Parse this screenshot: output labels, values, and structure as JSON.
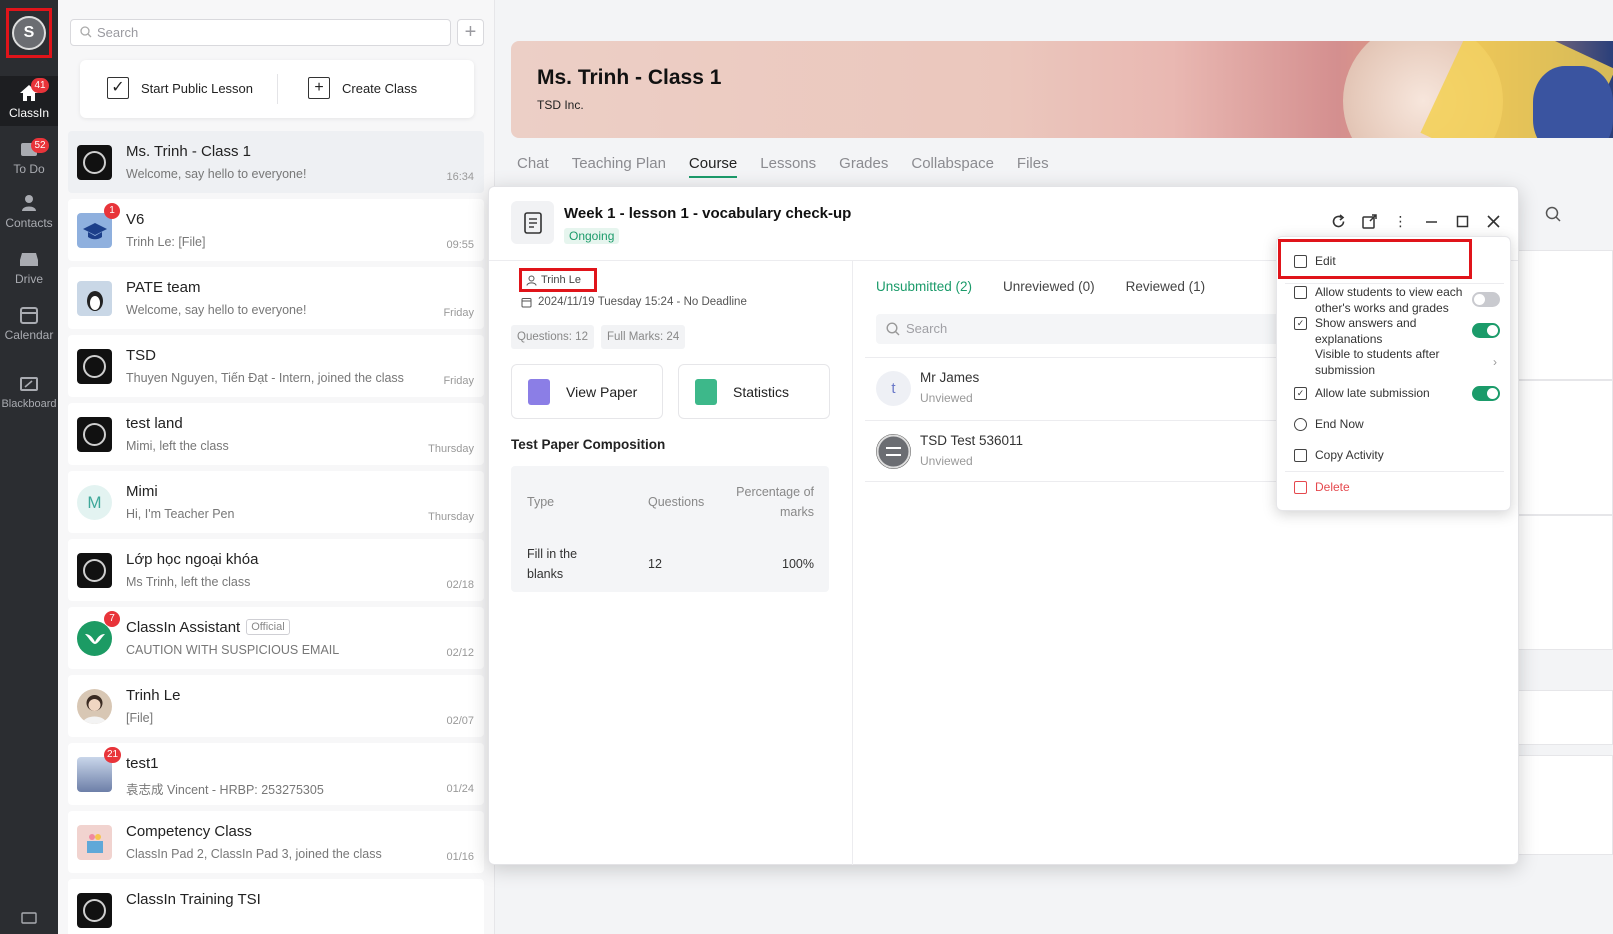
{
  "rail": {
    "items": [
      {
        "label": "ClassIn",
        "badge": "41",
        "icon": "home-icon"
      },
      {
        "label": "To Do",
        "badge": "52",
        "icon": "todo-icon"
      },
      {
        "label": "Contacts",
        "badge": "",
        "icon": "contacts-icon"
      },
      {
        "label": "Drive",
        "badge": "",
        "icon": "drive-icon"
      },
      {
        "label": "Calendar",
        "badge": "",
        "icon": "calendar-icon"
      },
      {
        "label": "Blackboard",
        "badge": "",
        "icon": "blackboard-icon"
      }
    ]
  },
  "list": {
    "search_placeholder": "Search",
    "start_public_lesson": "Start Public Lesson",
    "create_class": "Create Class",
    "chats": [
      {
        "title": "Ms. Trinh - Class 1",
        "sub": "Welcome, say hello to everyone!",
        "time": "16:34",
        "badge": ""
      },
      {
        "title": "V6",
        "sub": "Trinh Le: [File]",
        "time": "09:55",
        "badge": "1"
      },
      {
        "title": "PATE team",
        "sub": "Welcome, say hello to everyone!",
        "time": "Friday",
        "badge": ""
      },
      {
        "title": "TSD",
        "sub": "Thuyen Nguyen, Tiến Đạt - Intern, joined the class",
        "time": "Friday",
        "badge": ""
      },
      {
        "title": "test land",
        "sub": "Mimi, left the class",
        "time": "Thursday",
        "badge": ""
      },
      {
        "title": "Mimi",
        "sub": "Hi, I'm Teacher Pen",
        "time": "Thursday",
        "badge": ""
      },
      {
        "title": "Lớp học ngoại khóa",
        "sub": "Ms Trinh, left the class",
        "time": "02/18",
        "badge": ""
      },
      {
        "title": "ClassIn Assistant",
        "sub": "CAUTION WITH SUSPICIOUS EMAIL",
        "time": "02/12",
        "badge": "7",
        "tag": "Official"
      },
      {
        "title": "Trinh Le",
        "sub": "[File]",
        "time": "02/07",
        "badge": ""
      },
      {
        "title": "test1",
        "sub": "袁志成 Vincent - HRBP: 253275305",
        "time": "01/24",
        "badge": "21"
      },
      {
        "title": "Competency Class",
        "sub": "ClassIn Pad 2, ClassIn Pad 3, joined the class",
        "time": "01/16",
        "badge": ""
      },
      {
        "title": "ClassIn Training TSI",
        "sub": "",
        "time": "",
        "badge": ""
      }
    ],
    "mimi_initial": "M"
  },
  "class": {
    "title": "Ms. Trinh - Class 1",
    "org": "TSD Inc.",
    "tabs": [
      "Chat",
      "Teaching Plan",
      "Course",
      "Lessons",
      "Grades",
      "Collabspace",
      "Files"
    ],
    "active_tab": "Course"
  },
  "activity": {
    "title": "Week 1 - lesson 1 - vocabulary check-up",
    "status": "Ongoing",
    "owner": "Trinh Le",
    "date": "2024/11/19 Tuesday 15:24 - No Deadline",
    "questions_chip": "Questions: 12",
    "marks_chip": "Full Marks: 24",
    "view_paper": "View Paper",
    "statistics": "Statistics",
    "composition_title": "Test Paper Composition",
    "table": {
      "headers": [
        "Type",
        "Questions",
        "Percentage of marks"
      ],
      "row": [
        "Fill in the blanks",
        "12",
        "100%"
      ]
    },
    "sub_tabs": [
      "Unsubmitted (2)",
      "Unreviewed (0)",
      "Reviewed (1)"
    ],
    "search_placeholder": "Search",
    "students": [
      {
        "name": "Mr James",
        "status": "Unviewed",
        "initial": "t"
      },
      {
        "name": "TSD Test 536011",
        "status": "Unviewed",
        "initial": ""
      }
    ]
  },
  "menu": {
    "edit": "Edit",
    "allow_view": "Allow students to view each other's works and grades",
    "show_answers": "Show answers and explanations",
    "visible_after": "Visible to students after submission",
    "allow_late": "Allow late submission",
    "end_now": "End Now",
    "copy_activity": "Copy Activity",
    "delete": "Delete",
    "toggles": {
      "allow_view": false,
      "show_answers": true,
      "allow_late": true
    }
  },
  "colors": {
    "accent": "#1b9b6a",
    "danger": "#e5484d",
    "highlight": "#e0141a",
    "rail": "#2b2d31"
  }
}
